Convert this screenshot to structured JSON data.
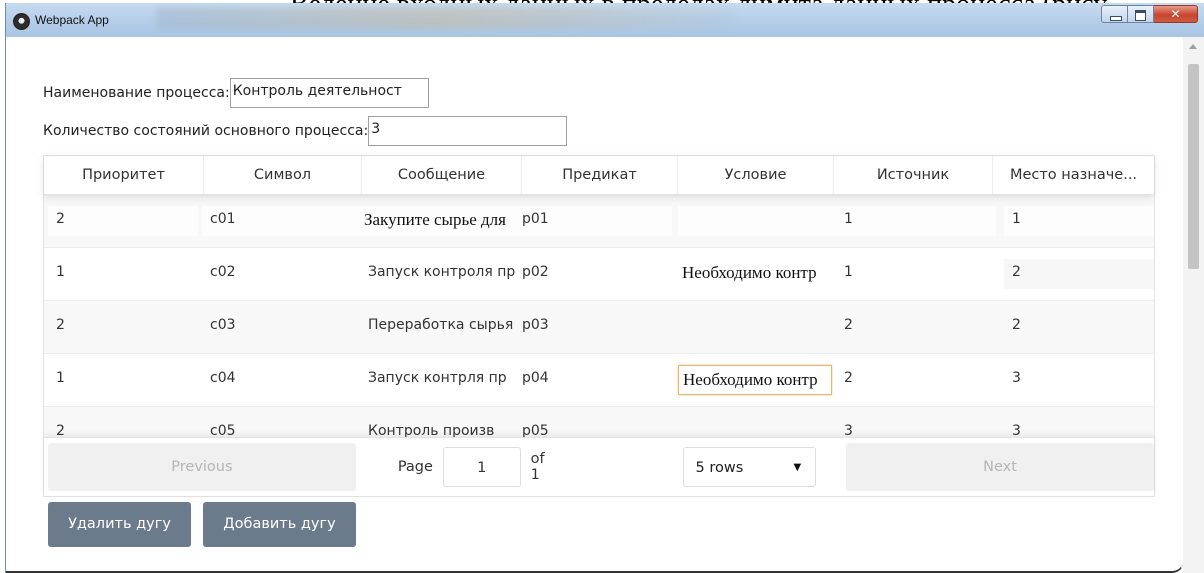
{
  "background_document_text": "Ведение входных данных в пределах лимита данных процесса (рису",
  "window": {
    "title": "Webpack App"
  },
  "form": {
    "process_name_label": "Наименование процесса:",
    "process_name_value": "Контроль деятельност",
    "states_count_label": "Количество состояний основного процесса:",
    "states_count_value": "3"
  },
  "table": {
    "columns": [
      "Приоритет",
      "Символ",
      "Сообщение",
      "Предикат",
      "Условие",
      "Источник",
      "Место назначе..."
    ],
    "rows": [
      {
        "priority": "2",
        "symbol": "c01",
        "message": "Закупите сырье для",
        "predicate": "p01",
        "condition": "",
        "source": "1",
        "destination": "1"
      },
      {
        "priority": "1",
        "symbol": "c02",
        "message": "Запуск контроля пр",
        "predicate": "p02",
        "condition": "Необходимо контр",
        "source": "1",
        "destination": "2"
      },
      {
        "priority": "2",
        "symbol": "c03",
        "message": "Переработка сырья",
        "predicate": "p03",
        "condition": "",
        "source": "2",
        "destination": "2"
      },
      {
        "priority": "1",
        "symbol": "c04",
        "message": " Запуск контрля пр",
        "predicate": "p04",
        "condition": "Необходимо контр",
        "source": "2",
        "destination": "3"
      },
      {
        "priority": "2",
        "symbol": "c05",
        "message": " Контроль произв",
        "predicate": "p05",
        "condition": "",
        "source": "3",
        "destination": "3"
      }
    ]
  },
  "pagination": {
    "previous_label": "Previous",
    "page_label": "Page",
    "page_value": "1",
    "of_label": "of 1",
    "rows_option": "5 rows",
    "next_label": "Next"
  },
  "buttons": {
    "delete_label": "Удалить дугу",
    "add_label": "Добавить дугу"
  }
}
